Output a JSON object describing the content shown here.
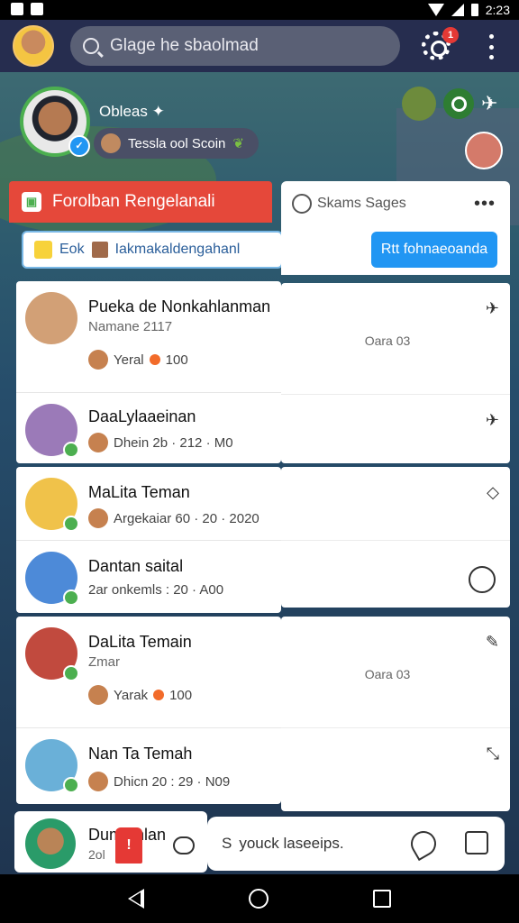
{
  "status_bar": {
    "time": "2:23"
  },
  "search": {
    "text": "Glage he sbaolmad"
  },
  "notifications": {
    "badge": "1"
  },
  "profile": {
    "name": "Obleas",
    "status_chip": "Tessla ool Scoin"
  },
  "tabs": {
    "active": "Forolban Rengelanali",
    "sub": {
      "prefix": "Eok",
      "label": "Iakmakaldengahanl"
    }
  },
  "panel": {
    "title": "Skams Sages",
    "button": "Rtt fohnaeoanda"
  },
  "friends": [
    {
      "name": "Pueka de Nonkahlanman",
      "sub": "Namane 2117",
      "meta": "Yeral",
      "points": "100",
      "avatar": "#d2a076"
    },
    {
      "name": "DaaLylaaeinan",
      "sub": "",
      "meta": "Dhein 2b · 212 · M0",
      "points": "",
      "avatar": "#9b7ab8"
    },
    {
      "name": "MaLita Teman",
      "sub": "",
      "meta": "Argekaiar 60 · 20 · 2020",
      "points": "",
      "avatar": "#f0c24a"
    },
    {
      "name": "Dantan saital",
      "sub": "",
      "meta": "2ar onkemls : 20 · A00",
      "points": "",
      "avatar": "#4d8ad8"
    },
    {
      "name": "DaLita Temain",
      "sub": "Zmar",
      "meta": "Yarak",
      "points": "100",
      "avatar": "#c14a3e"
    },
    {
      "name": "Nan Ta Temah",
      "sub": "",
      "meta": "Dhicn 20 : 29 · N09",
      "points": "",
      "avatar": "#6ab0d8"
    }
  ],
  "right_rows": [
    {
      "label": "Oara 03",
      "icon": "pin-icon"
    },
    {
      "label": "",
      "icon": "pin-icon"
    },
    {
      "label": "",
      "icon": "expand-icon"
    },
    {
      "label": "",
      "icon": "smile-icon"
    },
    {
      "label": "Oara 03",
      "icon": "edit-icon"
    },
    {
      "label": "",
      "icon": "collapse-icon"
    }
  ],
  "bottom_card": {
    "name": "Dumienlan",
    "sub": "2ol"
  },
  "composer": {
    "placeholder": "youck laseeips."
  }
}
